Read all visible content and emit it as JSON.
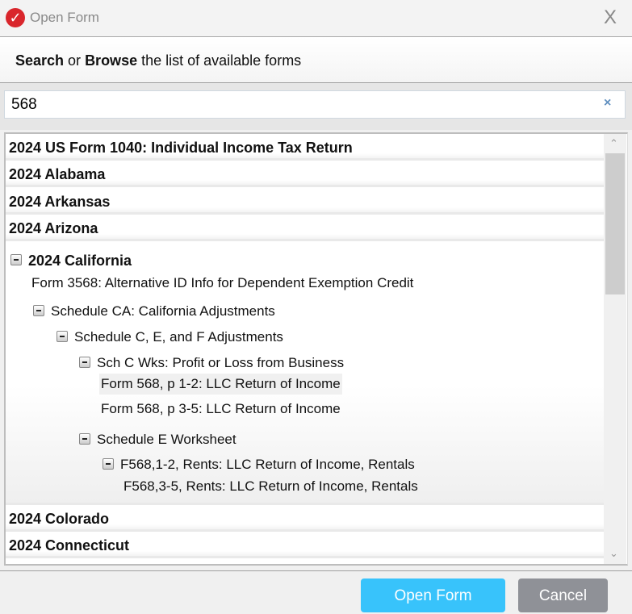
{
  "window": {
    "title": "Open Form",
    "close": "X"
  },
  "header": {
    "search_word": "Search",
    "or": " or ",
    "browse_word": "Browse",
    "rest": " the list of available forms"
  },
  "search": {
    "value": "568",
    "clear": "×"
  },
  "groups_top": [
    "2024 US Form 1040: Individual Income Tax Return",
    "2024 Alabama",
    "2024 Arkansas",
    "2024 Arizona"
  ],
  "california": {
    "label": "2024 California",
    "items": [
      "Form 3568: Alternative ID Info for Dependent Exemption Credit",
      "Schedule CA: California Adjustments",
      "Schedule C, E, and F Adjustments",
      "Sch C Wks: Profit or Loss from Business",
      "Form 568, p 1-2: LLC Return of Income",
      "Form 568, p 3-5: LLC Return of Income",
      "Schedule E Worksheet",
      "F568,1-2, Rents: LLC Return of Income, Rentals",
      "F568,3-5, Rents: LLC Return of Income, Rentals"
    ]
  },
  "groups_bottom": [
    "2024 Colorado",
    "2024 Connecticut"
  ],
  "buttons": {
    "open": "Open Form",
    "cancel": "Cancel"
  },
  "scroll": {
    "up": "⌃",
    "down": "⌄"
  }
}
